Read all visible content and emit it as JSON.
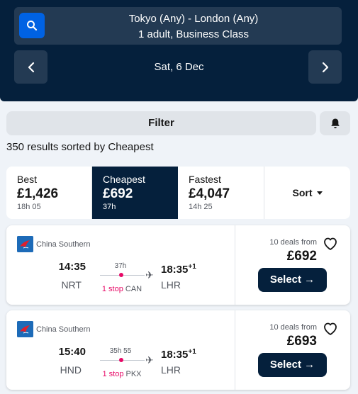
{
  "search": {
    "route": "Tokyo (Any) - London (Any)",
    "details": "1 adult, Business Class",
    "date": "Sat, 6 Dec"
  },
  "filter": {
    "filter_label": "Filter",
    "results_summary": "350 results sorted by Cheapest"
  },
  "sort_tabs": {
    "best": {
      "label": "Best",
      "price": "£1,426",
      "duration": "18h 05"
    },
    "cheapest": {
      "label": "Cheapest",
      "price": "£692",
      "duration": "37h"
    },
    "fastest": {
      "label": "Fastest",
      "price": "£4,047",
      "duration": "14h 25"
    },
    "sort_label": "Sort"
  },
  "results": [
    {
      "airline": "China Southern",
      "depart_time": "14:35",
      "depart_code": "NRT",
      "duration": "37h",
      "stops": "1 stop",
      "via": "CAN",
      "arrive_time": "18:35",
      "day_offset": "+1",
      "arrive_code": "LHR",
      "deals": "10 deals from",
      "price": "£692",
      "select_label": "Select →"
    },
    {
      "airline": "China Southern",
      "depart_time": "15:40",
      "depart_code": "HND",
      "duration": "35h 55",
      "stops": "1 stop",
      "via": "PKX",
      "arrive_time": "18:35",
      "day_offset": "+1",
      "arrive_code": "LHR",
      "deals": "10 deals from",
      "price": "£693",
      "select_label": "Select →"
    }
  ],
  "icons": {
    "search": "search-icon",
    "prev": "chevron-left-icon",
    "next": "chevron-right-icon",
    "bell": "bell-icon",
    "heart": "heart-icon",
    "plane": "plane-icon"
  },
  "colors": {
    "header_bg": "#05203c",
    "accent_blue": "#0062e3",
    "stop_pink": "#e70866"
  }
}
